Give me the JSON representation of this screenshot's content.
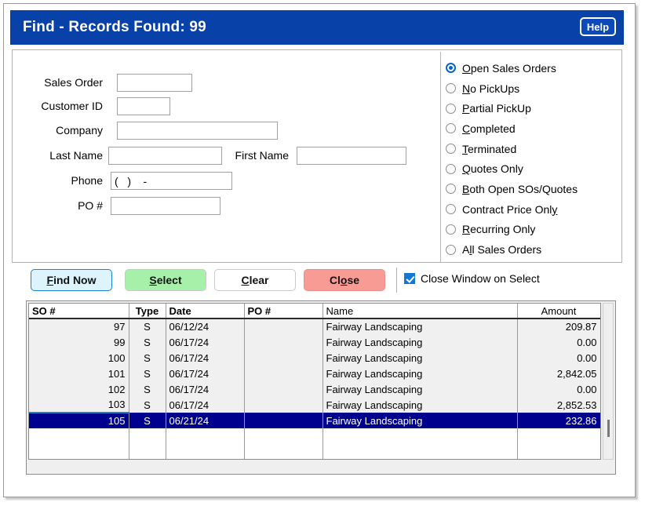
{
  "window": {
    "title": "Find - Records Found: 99",
    "help_label": "Help"
  },
  "form": {
    "fields": [
      {
        "label": "Sales Order",
        "value": "",
        "placeholder": ""
      },
      {
        "label": "Customer ID",
        "value": "",
        "placeholder": ""
      },
      {
        "label": "Company",
        "value": "",
        "placeholder": ""
      },
      {
        "label": "Last Name",
        "value": "",
        "placeholder": ""
      },
      {
        "label": "First Name",
        "value": "",
        "placeholder": ""
      },
      {
        "label": "Phone",
        "value": "(   )    -",
        "placeholder": ""
      },
      {
        "label": "PO #",
        "value": "",
        "placeholder": ""
      }
    ]
  },
  "filters": {
    "selected": "Open Sales Orders",
    "options": [
      {
        "label": "Open Sales Orders",
        "accel_index": 0,
        "selected": true
      },
      {
        "label": "No PickUps",
        "accel_index": 0,
        "selected": false
      },
      {
        "label": "Partial PickUp",
        "accel_index": 0,
        "selected": false
      },
      {
        "label": "Completed",
        "accel_index": 0,
        "selected": false
      },
      {
        "label": "Terminated",
        "accel_index": 0,
        "selected": false
      },
      {
        "label": "Quotes Only",
        "accel_index": 0,
        "selected": false
      },
      {
        "label": "Both Open SOs/Quotes",
        "accel_index": 0,
        "selected": false
      },
      {
        "label": "Contract Price Only",
        "accel_index": 18,
        "selected": false
      },
      {
        "label": "Recurring Only",
        "accel_index": 0,
        "selected": false
      },
      {
        "label": "All Sales Orders",
        "accel_index": 1,
        "selected": false
      }
    ]
  },
  "buttons": {
    "find_now": "Find Now",
    "find_now_accel": 0,
    "select": "Select",
    "select_accel": 0,
    "clear": "Clear",
    "clear_accel": 0,
    "close": "Close",
    "close_accel": 2
  },
  "close_on_select": {
    "label": "Close Window on Select",
    "checked": true
  },
  "grid": {
    "columns": [
      {
        "key": "so",
        "label": "SO #",
        "align": "right",
        "header_align": "left",
        "bold": true
      },
      {
        "key": "type",
        "label": "Type",
        "align": "center",
        "header_align": "center",
        "bold": true
      },
      {
        "key": "date",
        "label": "Date",
        "align": "left",
        "header_align": "left",
        "bold": true
      },
      {
        "key": "po",
        "label": "PO #",
        "align": "left",
        "header_align": "left",
        "bold": true
      },
      {
        "key": "name",
        "label": "Name",
        "align": "left",
        "header_align": "left",
        "bold": false
      },
      {
        "key": "amount",
        "label": "Amount",
        "align": "right",
        "header_align": "center",
        "bold": false
      }
    ],
    "rows": [
      {
        "so": "97",
        "type": "S",
        "date": "06/12/24",
        "po": "",
        "name": "Fairway Landscaping",
        "amount": "209.87",
        "selected": false
      },
      {
        "so": "99",
        "type": "S",
        "date": "06/17/24",
        "po": "",
        "name": "Fairway Landscaping",
        "amount": "0.00",
        "selected": false
      },
      {
        "so": "100",
        "type": "S",
        "date": "06/17/24",
        "po": "",
        "name": "Fairway Landscaping",
        "amount": "0.00",
        "selected": false
      },
      {
        "so": "101",
        "type": "S",
        "date": "06/17/24",
        "po": "",
        "name": "Fairway Landscaping",
        "amount": "2,842.05",
        "selected": false
      },
      {
        "so": "102",
        "type": "S",
        "date": "06/17/24",
        "po": "",
        "name": "Fairway Landscaping",
        "amount": "0.00",
        "selected": false
      },
      {
        "so": "103",
        "type": "S",
        "date": "06/17/24",
        "po": "",
        "name": "Fairway Landscaping",
        "amount": "2,852.53",
        "selected": false
      },
      {
        "so": "105",
        "type": "S",
        "date": "06/21/24",
        "po": "",
        "name": "Fairway Landscaping",
        "amount": "232.86",
        "selected": true
      }
    ],
    "empty_row_count": 2
  },
  "colors": {
    "titlebar": "#0841a8",
    "selection": "#00008f",
    "find_now": "#ddf4fd",
    "select": "#a7f0a9",
    "close": "#f99b95",
    "accent": "#1577d4"
  }
}
